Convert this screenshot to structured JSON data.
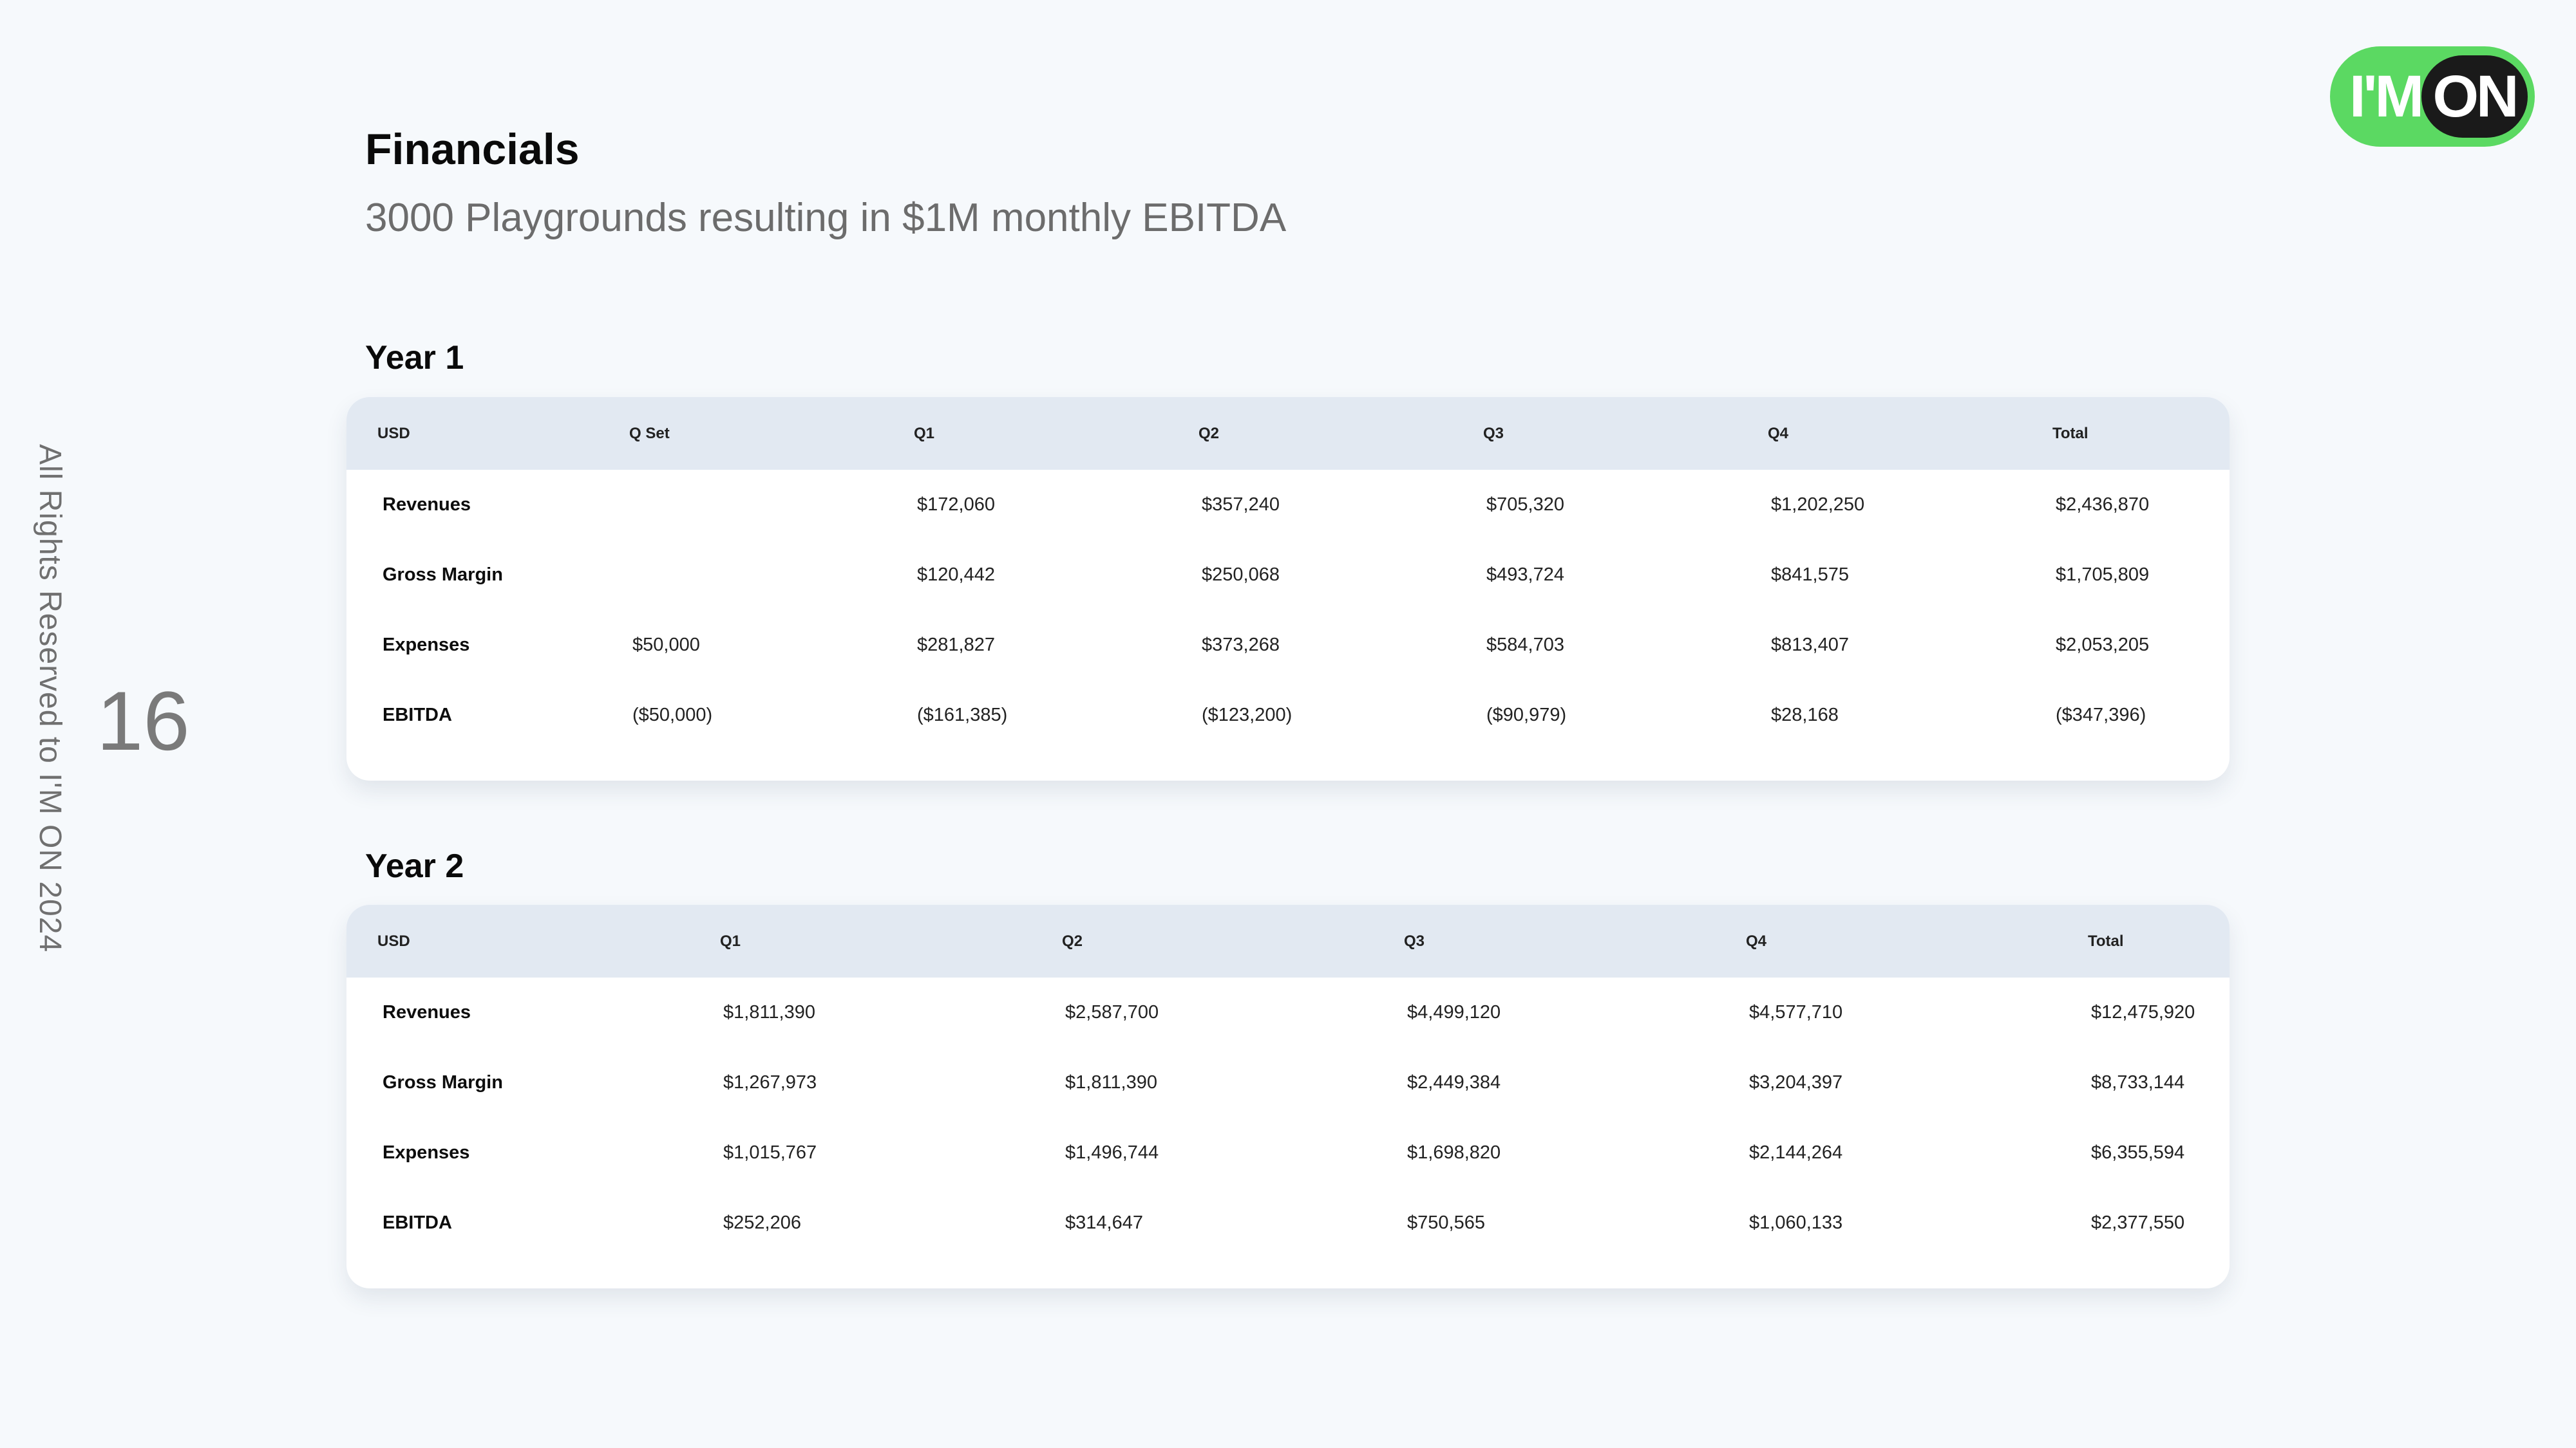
{
  "header": {
    "title": "Financials",
    "subtitle": "3000 Playgrounds resulting in $1M monthly EBITDA"
  },
  "sidebar": {
    "rights_text": "All Rights Reserved to I'M ON 2024",
    "page_number": "16"
  },
  "logo": {
    "left_text": "I'M",
    "right_text": "ON",
    "colors": {
      "green": "#5bd962",
      "dark": "#1a1a1a"
    }
  },
  "year1": {
    "heading": "Year 1",
    "columns": [
      "USD",
      "Q Set",
      "Q1",
      "Q2",
      "Q3",
      "Q4",
      "Total"
    ],
    "rows": [
      {
        "label": "Revenues",
        "cells": [
          "",
          "$172,060",
          "$357,240",
          "$705,320",
          "$1,202,250",
          "$2,436,870"
        ]
      },
      {
        "label": "Gross Margin",
        "cells": [
          "",
          "$120,442",
          "$250,068",
          "$493,724",
          "$841,575",
          "$1,705,809"
        ]
      },
      {
        "label": "Expenses",
        "cells": [
          "$50,000",
          "$281,827",
          "$373,268",
          "$584,703",
          "$813,407",
          "$2,053,205"
        ]
      },
      {
        "label": "EBITDA",
        "cells": [
          "($50,000)",
          "($161,385)",
          "($123,200)",
          "($90,979)",
          "$28,168",
          "($347,396)"
        ]
      }
    ]
  },
  "year2": {
    "heading": "Year 2",
    "columns": [
      "USD",
      "Q1",
      "Q2",
      "Q3",
      "Q4",
      "Total"
    ],
    "rows": [
      {
        "label": "Revenues",
        "cells": [
          "$1,811,390",
          "$2,587,700",
          "$4,499,120",
          "$4,577,710",
          "$12,475,920"
        ]
      },
      {
        "label": "Gross Margin",
        "cells": [
          "$1,267,973",
          "$1,811,390",
          "$2,449,384",
          "$3,204,397",
          "$8,733,144"
        ]
      },
      {
        "label": "Expenses",
        "cells": [
          "$1,015,767",
          "$1,496,744",
          "$1,698,820",
          "$2,144,264",
          "$6,355,594"
        ]
      },
      {
        "label": "EBITDA",
        "cells": [
          "$252,206",
          "$314,647",
          "$750,565",
          "$1,060,133",
          "$2,377,550"
        ]
      }
    ]
  },
  "colors": {
    "background": "#f6f9fc",
    "table_header": "#e2e9f2",
    "subtitle": "#6c6c6c"
  }
}
